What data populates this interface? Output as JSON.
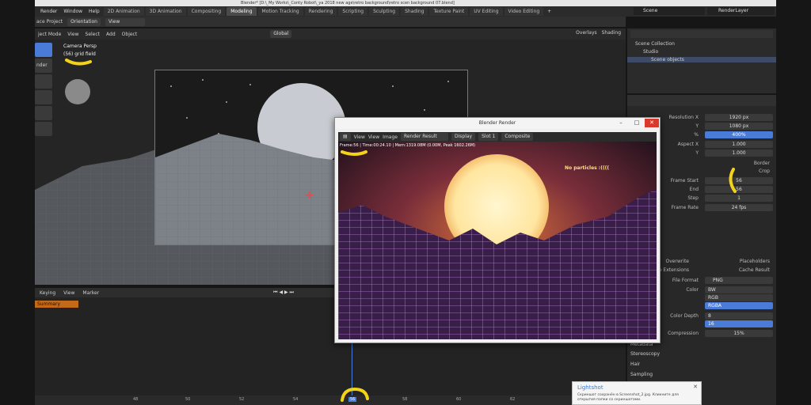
{
  "titlebar": {
    "text": "Blender* [D:\\_My Works\\_Conty Robot\\_ya 2018 new age\\retro background\\retro scen background 07.blend]"
  },
  "menubar": {
    "items": [
      "Render",
      "Window",
      "Help"
    ],
    "workspace_tabs": [
      "2D Animation",
      "3D Animation",
      "Compositing",
      "Modeling",
      "Motion Tracking",
      "Rendering",
      "Scripting",
      "Sculpting",
      "Shading",
      "Texture Paint",
      "UV Editing",
      "Video Editing"
    ],
    "active_tab": "Modeling",
    "scene": "Scene",
    "view_layer": "RenderLayer"
  },
  "header2": {
    "left": "ace Project",
    "orientation": "Orientation",
    "view": "View"
  },
  "viewport_header": {
    "mode": "ject Mode",
    "menus": [
      "View",
      "Select",
      "Add",
      "Object"
    ],
    "transform": "Global",
    "overlays": "Overlays",
    "shading": "Shading"
  },
  "viewport": {
    "camera_label": "Camera Persp",
    "collection_label": "(56) grid field"
  },
  "toolbar_left": {
    "render_label": "nder"
  },
  "timeline": {
    "menus": [
      "Keying",
      "View",
      "Marker"
    ],
    "summary": "Summary",
    "ticks": [
      "48",
      "50",
      "52",
      "54",
      "56",
      "58",
      "60",
      "62"
    ],
    "current_frame": "56"
  },
  "outliner": {
    "items": [
      "Scene Collection",
      "Studio",
      "Scene objects"
    ]
  },
  "properties": {
    "resolution_x_label": "Resolution X",
    "resolution_x": "1920 px",
    "y_label": "Y",
    "resolution_y": "1080 px",
    "percent_label": "%",
    "percent": "400%",
    "aspect_x_label": "Aspect X",
    "aspect_x": "1.000",
    "aspect_y_label": "Y",
    "aspect_y": "1.000",
    "border_label": "Border",
    "crop_label": "Crop",
    "frame_start_label": "Frame Start",
    "frame_start": "56",
    "end_label": "End",
    "frame_end": "56",
    "step_label": "Step",
    "step": "1",
    "frame_rate_label": "Frame Rate",
    "frame_rate": "24 fps",
    "apping": "apping",
    "pping": "pping",
    "overwrite_label": "Overwrite",
    "placeholders_label": "Placeholders",
    "file_ext_label": "File Extensions",
    "cache_label": "Cache Result",
    "file_format_label": "File Format",
    "file_format": "PNG",
    "color_label": "Color",
    "color_bw": "BW",
    "color_rgb": "RGB",
    "color_rgba": "RGBA",
    "color_depth_label": "Color Depth",
    "depth_8": "8",
    "depth_16": "16",
    "compression_label": "Compression",
    "compression": "15%",
    "metadata": "Metadata",
    "stereoscopy": "Stereoscopy",
    "hair": "Hair",
    "sampling": "Sampling"
  },
  "render_window": {
    "title": "Blender Render",
    "menus": [
      "View",
      "View",
      "Image"
    ],
    "slot_result": "Render Result",
    "display": "Display",
    "slot": "Slot 1",
    "composite": "Composite",
    "stats": "Frame:56 | Time:00:24.10 | Mem:1319.08M (0.00M, Peak 1602.26M)",
    "annotation": "No particles :(((("
  },
  "lightshot": {
    "title": "Lightshot",
    "body": "Скриншот сохранён в Screenshot_2.jpg. Кликните для открытия папки со скриншотами."
  },
  "colors": {
    "accent": "#4a7bd6",
    "summary": "#c26a1a",
    "highlight": "#f2d31a",
    "close": "#d93a2d"
  }
}
